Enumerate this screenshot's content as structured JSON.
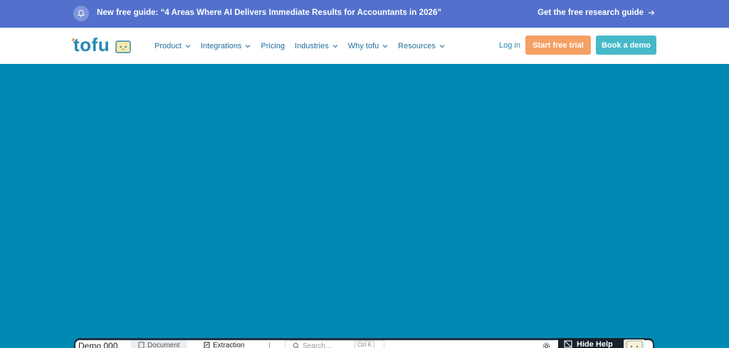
{
  "announcement": {
    "message": "New free guide: “4 Areas Where AI Delivers Immediate Results for Accountants in 2026”",
    "link_label": "Get the free research guide"
  },
  "nav": {
    "logo_text": "tofu",
    "items": [
      {
        "label": "Product",
        "has_dropdown": true
      },
      {
        "label": "Integrations",
        "has_dropdown": true
      },
      {
        "label": "Pricing",
        "has_dropdown": false
      },
      {
        "label": "Industries",
        "has_dropdown": true
      },
      {
        "label": "Why tofu",
        "has_dropdown": true
      },
      {
        "label": "Resources",
        "has_dropdown": true
      }
    ],
    "login_label": "Log in",
    "trial_label": "Start free trial",
    "demo_label": "Book a demo"
  },
  "app_preview": {
    "title": "Demo 000",
    "tabs": [
      "Document",
      "Extraction"
    ],
    "search_placeholder": "Search...",
    "shortcut": "Ctrl K",
    "hide_help_label": "Hide Help"
  },
  "colors": {
    "announcement_bg": "#5371cc",
    "hero_bg": "#008ab3",
    "trial_button": "#f5a065",
    "demo_button": "#46b9c9",
    "nav_text": "#1f6f9e"
  }
}
